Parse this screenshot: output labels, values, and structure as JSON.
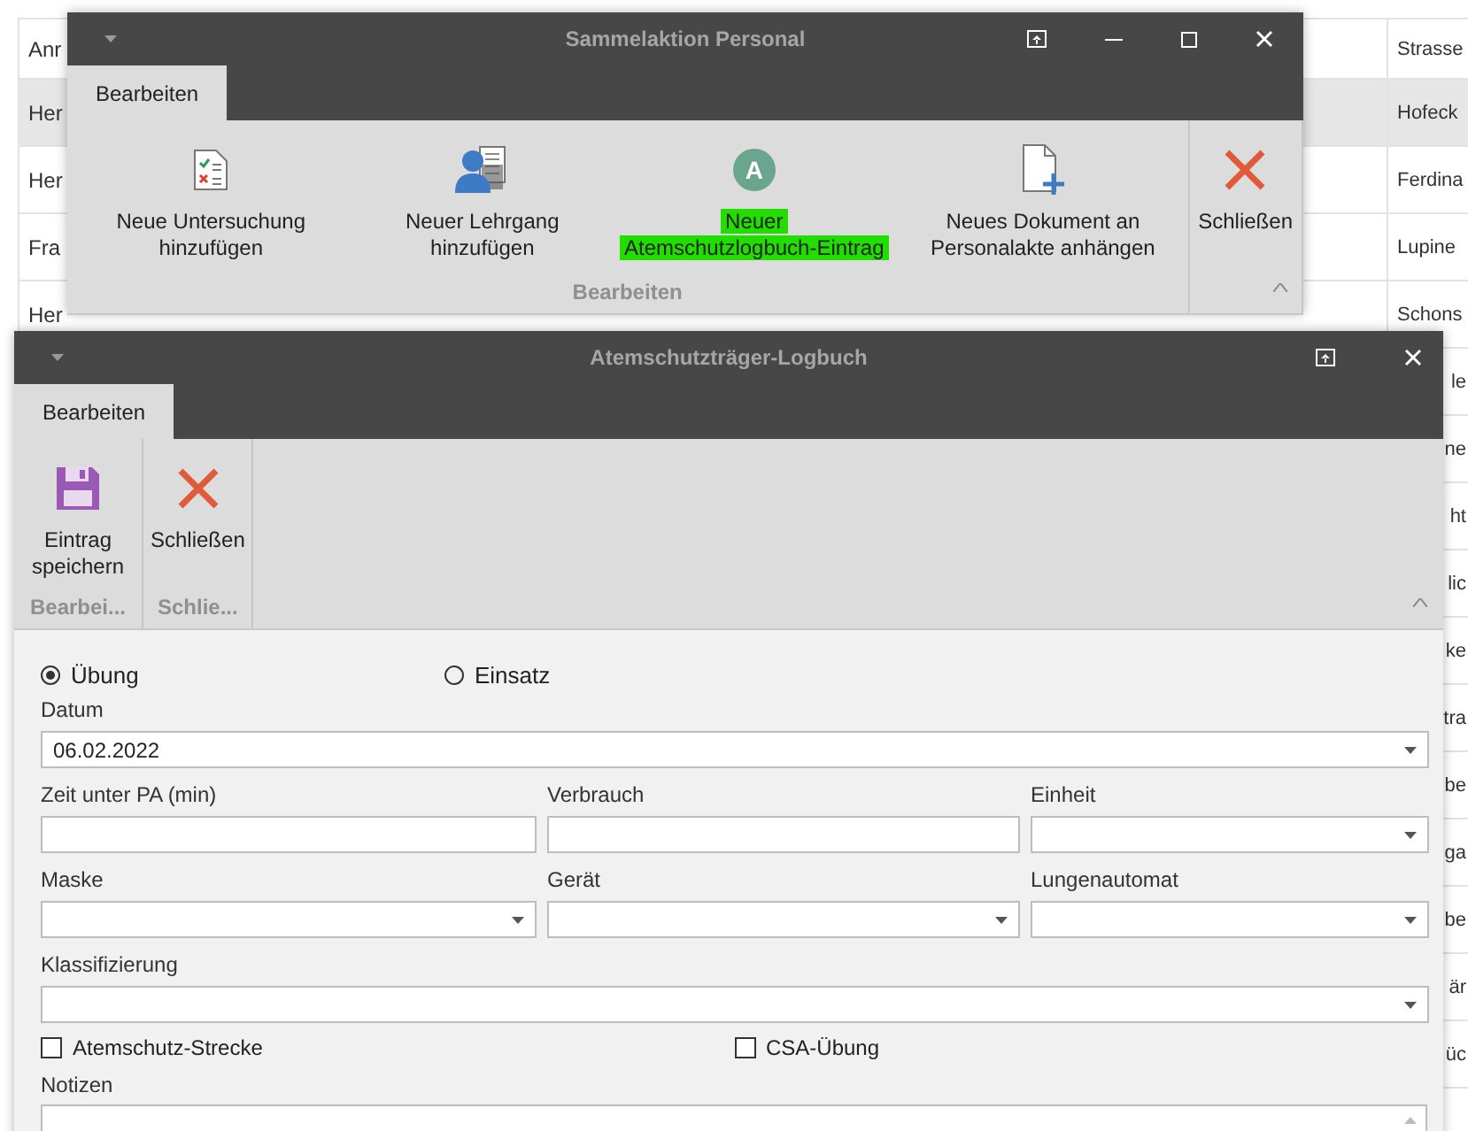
{
  "background_table": {
    "columns": [
      "Anr",
      "Strasse"
    ],
    "rows": [
      {
        "column_1": "Her",
        "strasse": "Hofeck",
        "selected": true
      },
      {
        "column_1": "Her",
        "strasse": "Ferdina",
        "selected": false
      },
      {
        "column_1": "Fra",
        "strasse": "Lupine",
        "selected": false
      },
      {
        "column_1": "Her",
        "strasse": "Schons",
        "selected": false
      },
      {
        "strasse": "le",
        "selected": false
      },
      {
        "strasse": "ne",
        "selected": false
      },
      {
        "strasse": "ht",
        "selected": false
      },
      {
        "strasse": "lic",
        "selected": false
      },
      {
        "strasse": "ke",
        "selected": false
      },
      {
        "strasse": "tra",
        "selected": false
      },
      {
        "strasse": "be",
        "selected": false
      },
      {
        "strasse": "ga",
        "selected": false
      },
      {
        "strasse": "be",
        "selected": false
      },
      {
        "strasse": "är",
        "selected": false
      },
      {
        "strasse": "üc",
        "selected": false
      }
    ]
  },
  "window_1": {
    "title": "Sammelaktion Personal",
    "tabs": [
      {
        "label": "Bearbeiten",
        "selected": true
      }
    ],
    "groups": [
      {
        "label": "Bearbeiten",
        "buttons": [
          {
            "kind": "exam",
            "label": "Neue Untersuchung hinzufügen",
            "highlighted": false
          },
          {
            "kind": "course",
            "label": "Neuer Lehrgang hinzufügen",
            "highlighted": false
          },
          {
            "kind": "letter",
            "icon_letter": "A",
            "lines": [
              "Neuer",
              "Atemschutzlogbuch-Eintrag"
            ],
            "highlighted": true
          },
          {
            "kind": "document",
            "label": "Neues Dokument an Personalakte anhängen",
            "highlighted": false
          }
        ]
      },
      {
        "buttons": [
          {
            "kind": "close",
            "label": "Schließen",
            "highlighted": false
          }
        ]
      }
    ]
  },
  "window_2": {
    "title": "Atemschutzträger-Logbuch",
    "tabs": [
      {
        "label": "Bearbeiten",
        "selected": true
      }
    ],
    "groups": [
      {
        "label": "Bearbei...",
        "buttons": [
          {
            "kind": "save",
            "label": "Eintrag speichern"
          }
        ]
      },
      {
        "label": "Schlie...",
        "buttons": [
          {
            "kind": "close",
            "label": "Schließen"
          }
        ]
      }
    ],
    "radios": [
      {
        "label": "Übung",
        "selected": true
      },
      {
        "label": "Einsatz",
        "selected": false
      }
    ],
    "field_rows": [
      [
        {
          "label": "Datum",
          "value": "06.02.2022",
          "kind": "dropdown"
        }
      ],
      [
        {
          "label": "Zeit unter PA (min)",
          "kind": "text"
        },
        {
          "label": "Verbrauch",
          "kind": "text"
        },
        {
          "label": "Einheit",
          "kind": "dropdown"
        }
      ],
      [
        {
          "label": "Maske",
          "kind": "dropdown"
        },
        {
          "label": "Gerät",
          "kind": "dropdown"
        },
        {
          "label": "Lungenautomat",
          "kind": "dropdown"
        }
      ],
      [
        {
          "label": "Klassifizierung",
          "kind": "dropdown"
        }
      ]
    ],
    "checkboxes": [
      {
        "label": "Atemschutz-Strecke",
        "checked": false
      },
      {
        "label": "CSA-Übung",
        "checked": false
      }
    ],
    "notes": {
      "label": "Notizen"
    }
  }
}
